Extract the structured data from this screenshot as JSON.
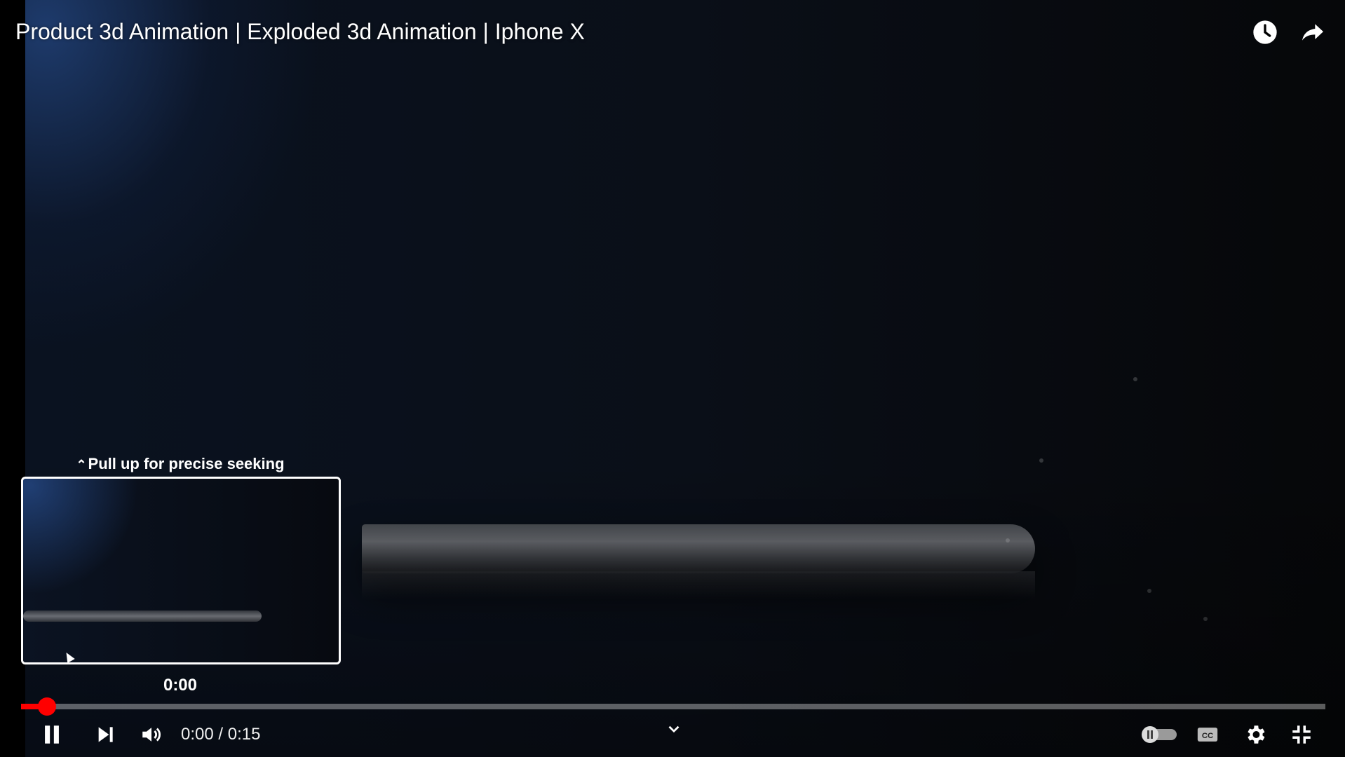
{
  "video": {
    "title": "Product 3d Animation | Exploded 3d Animation | Iphone X",
    "progress_fraction": 0.02
  },
  "top_bar": {
    "watch_later_icon": "clock-icon",
    "share_icon": "share-arrow-icon"
  },
  "seek_preview": {
    "hint": "Pull up for precise seeking",
    "time": "0:00"
  },
  "controls": {
    "current_time": "0:00",
    "separator": " / ",
    "duration": "0:15",
    "icons": {
      "play_pause": "pause-icon",
      "next": "skip-next-icon",
      "volume": "volume-icon",
      "collapse": "chevron-down-icon",
      "autoplay": "autoplay-toggle-icon",
      "captions": "cc-icon",
      "settings": "gear-icon",
      "fullscreen": "exit-fullscreen-icon"
    }
  },
  "colors": {
    "accent": "#ff0000",
    "text": "#ffffff"
  }
}
